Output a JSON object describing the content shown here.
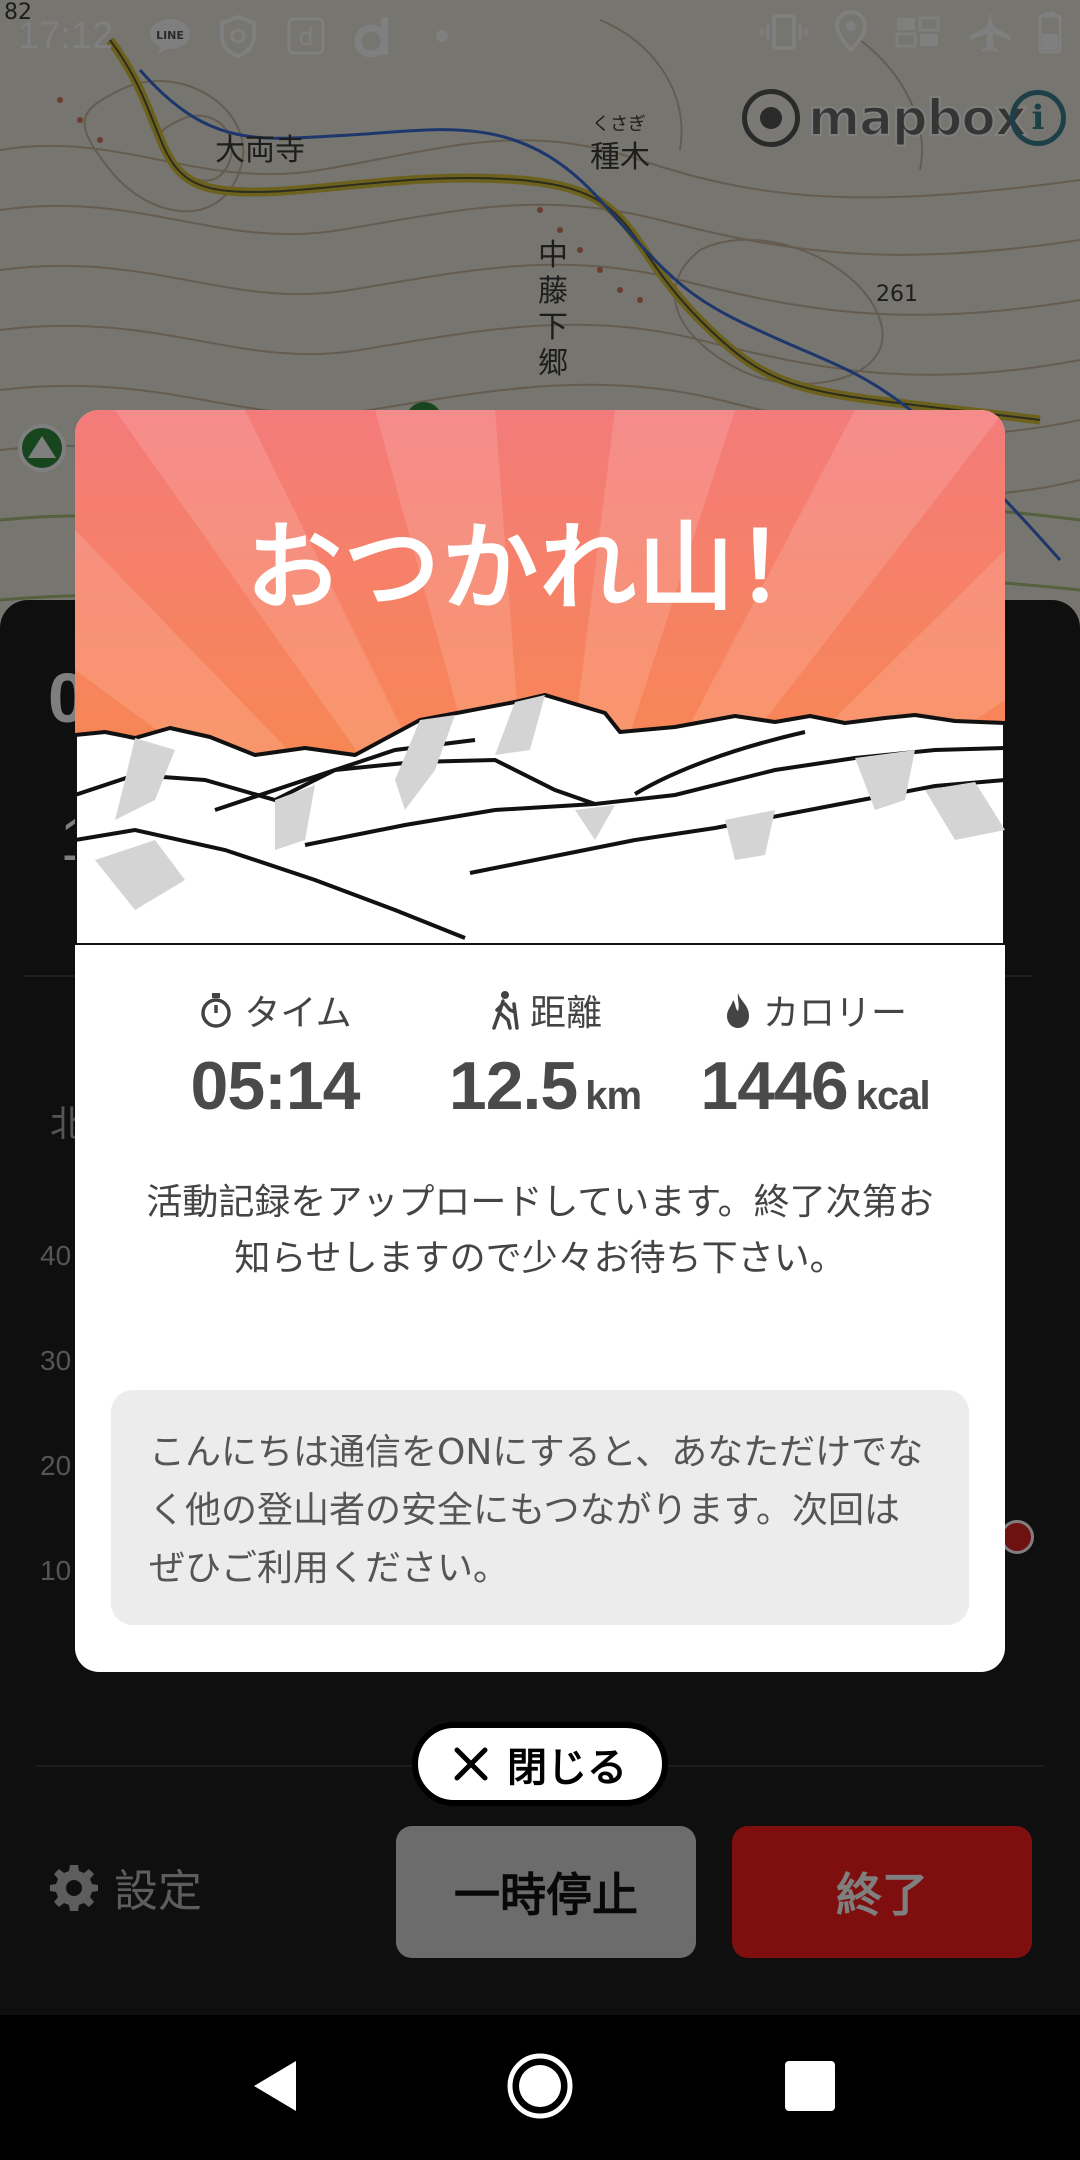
{
  "status_bar": {
    "time": "17:12",
    "icons": [
      "line-icon",
      "shield-icon",
      "d-app-icon",
      "d-brand-icon",
      "dot-icon"
    ],
    "right_icons": [
      "vibrate-icon",
      "location-icon",
      "data-icon",
      "airplane-icon",
      "battery-icon"
    ]
  },
  "map": {
    "labels": {
      "temple": "大両寺",
      "tanegi_ruby": "くさぎ",
      "tanegi": "種木",
      "nakafuji": "中藤下郷",
      "elevation": "261",
      "corner": "82"
    },
    "mapbox_text": "mapbox",
    "info": "i"
  },
  "sheet": {
    "settings_label": "設定",
    "pause_label": "一時停止",
    "end_label": "終了",
    "ghost": {
      "stat_left": "0",
      "stat_left2": "1",
      "north": "北",
      "y40": "40",
      "y30": "30",
      "y20": "20",
      "y10": "10"
    }
  },
  "dialog": {
    "title": "おつかれ山！",
    "stats": [
      {
        "label": "タイム",
        "value": "05:14",
        "unit": "",
        "icon": "stopwatch-icon"
      },
      {
        "label": "距離",
        "value": "12.5",
        "unit": "km",
        "icon": "hiker-icon"
      },
      {
        "label": "カロリー",
        "value": "1446",
        "unit": "kcal",
        "icon": "flame-icon"
      }
    ],
    "upload_message": "活動記録をアップロードしています。終了次第お知らせしますので少々お待ち下さい。",
    "info_message": "こんにちは通信をONにすると、あなただけでなく他の登山者の安全にもつながります。次回はぜひご利用ください。"
  },
  "close_button": {
    "label": "閉じる"
  },
  "colors": {
    "hero_top": "#f47b7b",
    "hero_bottom": "#f98a3e",
    "end_button": "#ff1f1f",
    "pause_button": "#d8d8d8"
  }
}
